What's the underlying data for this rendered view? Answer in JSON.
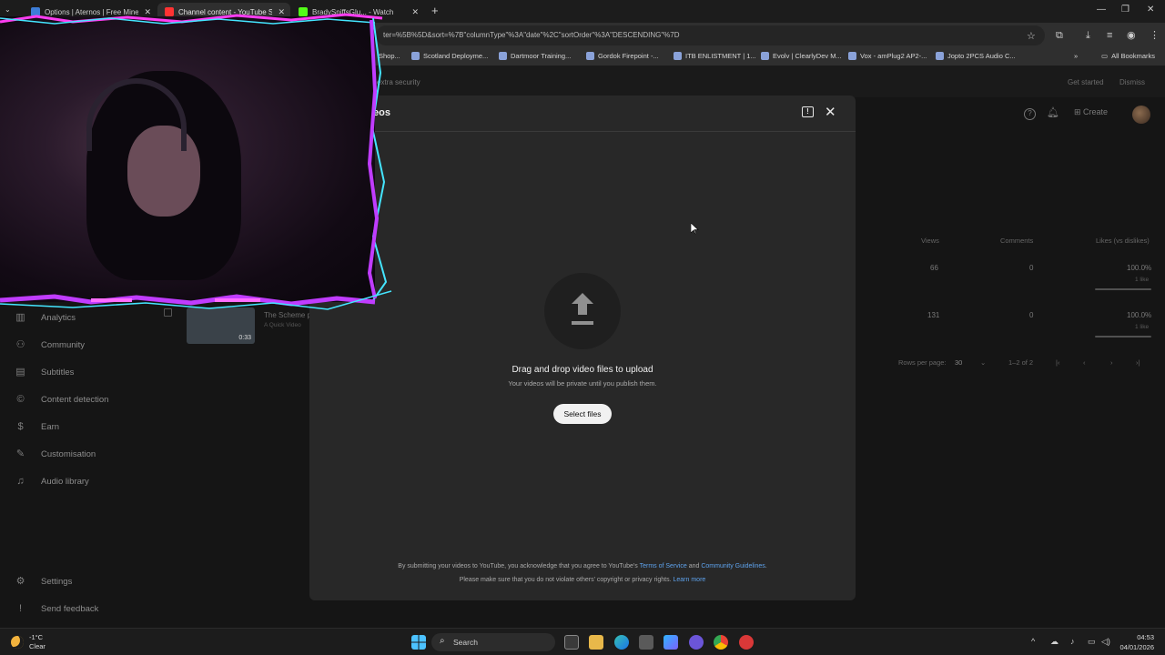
{
  "browser": {
    "tabs": [
      {
        "title": "Options | Aternos | Free Minecr",
        "active": false,
        "favicon_color": "#3d7dd8"
      },
      {
        "title": "Channel content - YouTube Stu",
        "active": true,
        "favicon_color": "#ff3333"
      },
      {
        "title": "BradySniffsGlu... - Watch",
        "active": false,
        "favicon_color": "#53fc18"
      }
    ],
    "url": "ter=%5B%5D&sort=%7B\"columnType\"%3A\"date\"%2C\"sortOrder\"%3A\"DESCENDING\"%7D",
    "bookmarks": [
      "Shop...",
      "Scotland Deployme...",
      "Dartmoor Training...",
      "Gordok Firepoint -...",
      "ITB ENLISTMENT | 1...",
      "Evolv | ClearlyDev M...",
      "Vox - amPlug2 AP2-...",
      "Jopto 2PCS Audio C..."
    ],
    "all_bookmarks": "All Bookmarks"
  },
  "studio": {
    "banner_text": "extra security",
    "banner_actions": [
      "Get started",
      "Dismiss"
    ],
    "create_label": "Create",
    "sidebar": [
      {
        "label": "Analytics",
        "icon": "analytics-icon"
      },
      {
        "label": "Community",
        "icon": "community-icon"
      },
      {
        "label": "Subtitles",
        "icon": "subtitles-icon"
      },
      {
        "label": "Content detection",
        "icon": "copyright-icon"
      },
      {
        "label": "Earn",
        "icon": "dollar-icon"
      },
      {
        "label": "Customisation",
        "icon": "wand-icon"
      },
      {
        "label": "Audio library",
        "icon": "audio-library-icon"
      }
    ],
    "sidebar_bottom": [
      {
        "label": "Settings",
        "icon": "gear-icon"
      },
      {
        "label": "Send feedback",
        "icon": "feedback-icon"
      }
    ],
    "columns": [
      "Views",
      "Comments",
      "Likes (vs dislikes)"
    ],
    "rows": [
      {
        "views": "66",
        "comments": "0",
        "likes": "100.0%",
        "like_count": "1 like"
      },
      {
        "views": "131",
        "comments": "0",
        "likes": "100.0%",
        "like_count": "1 like"
      }
    ],
    "video": {
      "title": "The Scheme p",
      "subtitle": "A Quick Video",
      "duration": "0:33"
    },
    "pagination": {
      "rows_label": "Rows per page:",
      "rows_value": "30",
      "range": "1–2 of 2"
    }
  },
  "modal": {
    "title": "eos",
    "drag_text": "Drag and drop video files to upload",
    "private_text": "Your videos will be private until you publish them.",
    "select_button": "Select files",
    "terms_prefix": "By submitting your videos to YouTube, you acknowledge that you agree to YouTube's",
    "terms_link": "Terms of Service",
    "terms_and": "and",
    "guidelines_link": "Community Guidelines",
    "terms_line2": "Please make sure that you do not violate others' copyright or privacy rights.",
    "learn_more": "Learn more"
  },
  "taskbar": {
    "temperature": "-1°C",
    "weather": "Clear",
    "search_placeholder": "Search",
    "time": "04:53",
    "date": "04/01/2026"
  }
}
